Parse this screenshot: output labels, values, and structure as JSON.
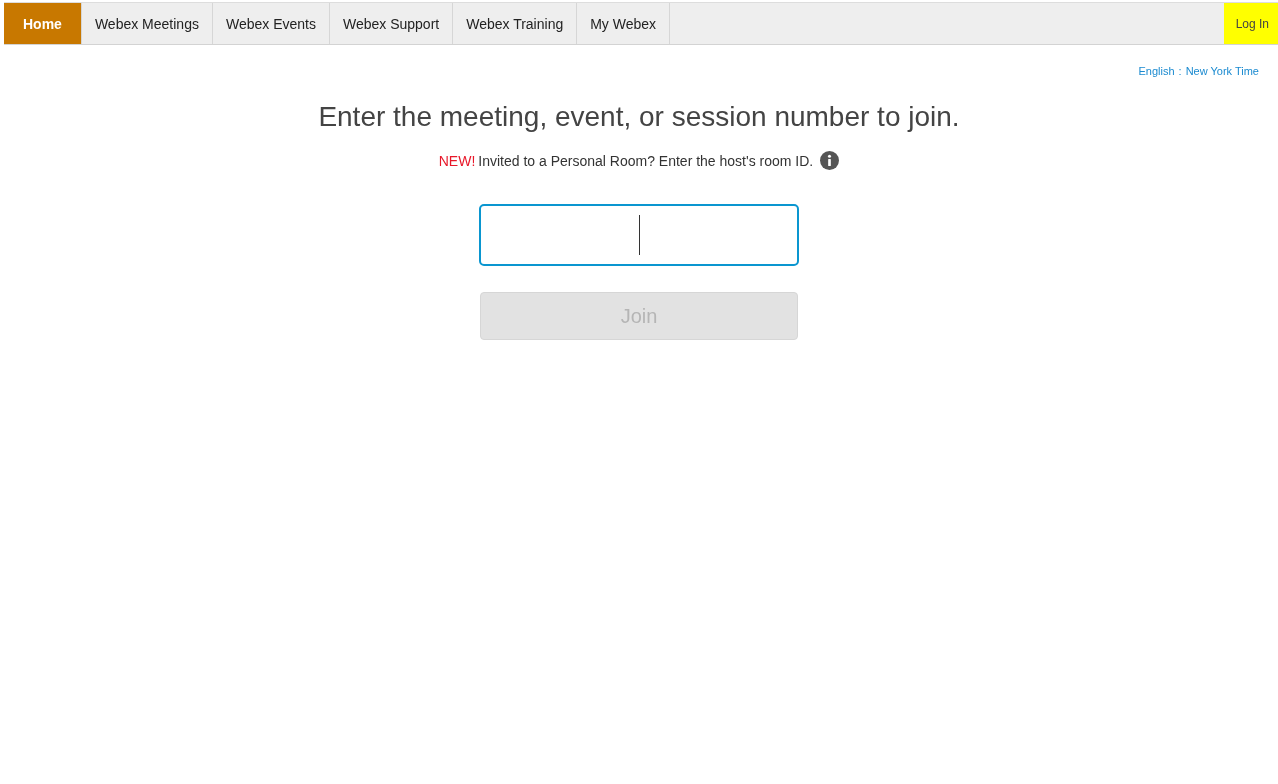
{
  "nav": {
    "tabs": [
      {
        "label": "Home",
        "selected": true
      },
      {
        "label": "Webex Meetings",
        "selected": false
      },
      {
        "label": "Webex Events",
        "selected": false
      },
      {
        "label": "Webex Support",
        "selected": false
      },
      {
        "label": "Webex Training",
        "selected": false
      },
      {
        "label": "My Webex",
        "selected": false
      }
    ],
    "login": {
      "label": "Log In",
      "highlighted": true
    }
  },
  "locale": {
    "language": "English",
    "separator": ":",
    "timezone": "New York Time"
  },
  "join": {
    "heading": "Enter the meeting, event, or session number to join.",
    "notice_badge": "NEW!",
    "notice": "Invited to a Personal Room? Enter the host's room ID.",
    "field": {
      "focused": true
    },
    "button": {
      "label": "Join",
      "disabled": true
    }
  }
}
